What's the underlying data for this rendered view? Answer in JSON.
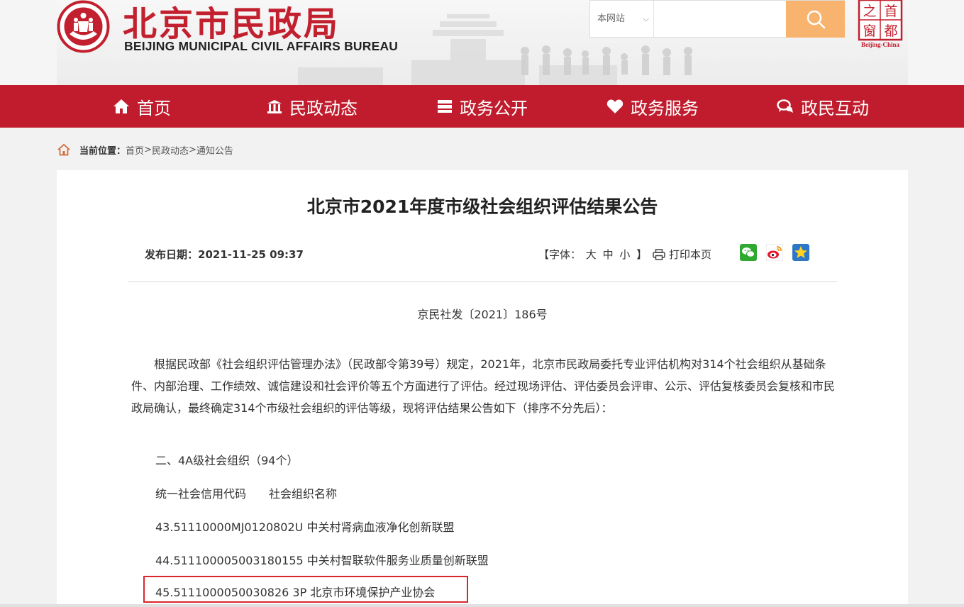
{
  "header": {
    "brand_cn": "北京市民政局",
    "brand_en": "BEIJING MUNICIPAL CIVIL AFFAIRS BUREAU",
    "search": {
      "scope_selected": "本网站",
      "placeholder": "",
      "value": ""
    },
    "stamp": {
      "chars": [
        "首",
        "都",
        "之",
        "窗"
      ],
      "caption": "Beijing-China"
    }
  },
  "nav": {
    "items": [
      {
        "label": "首页",
        "icon": "home-icon"
      },
      {
        "label": "民政动态",
        "icon": "building-icon"
      },
      {
        "label": "政务公开",
        "icon": "stack-icon"
      },
      {
        "label": "政务服务",
        "icon": "heart-icon"
      },
      {
        "label": "政民互动",
        "icon": "chat-icon"
      }
    ]
  },
  "breadcrumb": {
    "label": "当前位置：",
    "items": [
      "首页",
      "民政动态",
      "通知公告"
    ],
    "separator": ">"
  },
  "article": {
    "title": "北京市2021年度市级社会组织评估结果公告",
    "pub_date_label": "发布日期：",
    "pub_date": "2021-11-25 09:37",
    "font_size": {
      "open": "【字体：",
      "large": "大",
      "medium": "中",
      "small": "小",
      "close": "】"
    },
    "print_label": "打印本页",
    "doc_number": "京民社发〔2021〕186号",
    "paragraph": "根据民政部《社会组织评估管理办法》（民政部令第39号）规定，2021年，北京市民政局委托专业评估机构对314个社会组织从基础条件、内部治理、工作绩效、诚信建设和社会评价等五个方面进行了评估。经过现场评估、评估委员会评审、公示、评估复核委员会复核和市民政局确认，最终确定314个市级社会组织的评估等级，现将评估结果公告如下（排序不分先后）：",
    "section_heading": "二、4A级社会组织（94个）",
    "table_header": "统一社会信用代码　　社会组织名称",
    "rows": [
      "43.51110000MJ0120802U  中关村肾病血液净化创新联盟",
      "44.511100005003180155  中关村智联软件服务业质量创新联盟",
      "45.5111000050030826 3P  北京市环境保护产业协会"
    ]
  },
  "colors": {
    "brand_red": "#c01c2d",
    "search_button": "#f8b36e",
    "highlight_border": "#d9262b"
  }
}
